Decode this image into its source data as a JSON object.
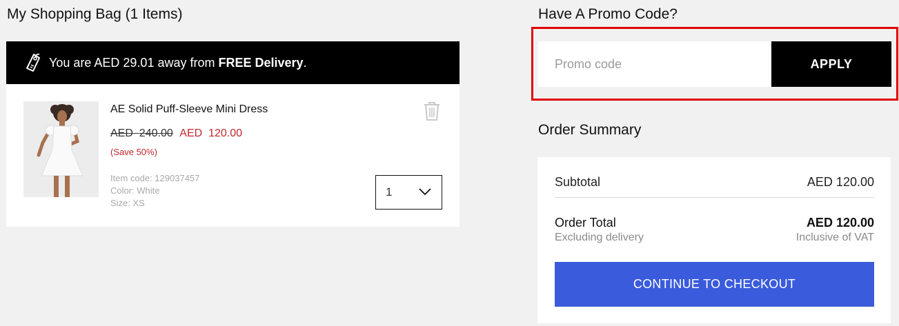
{
  "bag": {
    "title": "My Shopping Bag (1 Items)",
    "banner": {
      "prefix": "You are AED 29.01 away from ",
      "emphasis": "FREE Delivery",
      "suffix": ".",
      "icon": "tag-icon"
    },
    "item": {
      "name": "AE Solid Puff-Sleeve Mini Dress",
      "old_currency": "AED",
      "old_price": "240.00",
      "new_currency": "AED",
      "new_price": "120.00",
      "save": "(Save 50%)",
      "item_code": "Item code: 129037457",
      "color": "Color: White",
      "size": "Size: XS",
      "quantity": "1",
      "delete_icon": "trash-icon"
    }
  },
  "promo": {
    "title": "Have A Promo Code?",
    "placeholder": "Promo code",
    "value": "",
    "apply_label": "APPLY"
  },
  "summary": {
    "title": "Order Summary",
    "subtotal_label": "Subtotal",
    "subtotal_value": "AED 120.00",
    "total_label": "Order Total",
    "total_value": "AED 120.00",
    "delivery_note": "Excluding delivery",
    "vat_note": "Inclusive of VAT",
    "checkout_label": "CONTINUE TO CHECKOUT"
  },
  "colors": {
    "banner_bg": "#000000",
    "sale_red": "#c1272d",
    "checkout_blue": "#3a5bdb",
    "highlight_red": "#e00000"
  }
}
